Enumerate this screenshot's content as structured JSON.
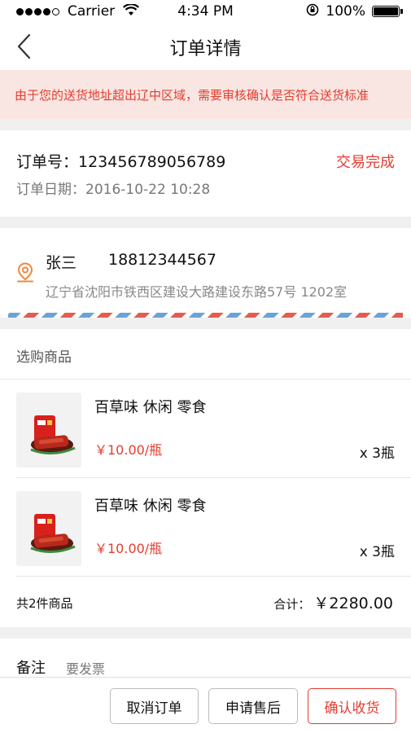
{
  "status_bar": {
    "carrier": "Carrier",
    "time": "4:34 PM",
    "battery_percent": "100%",
    "battery_level": 1.0,
    "signal_bars_filled": 4,
    "signal_bars_total": 5
  },
  "nav": {
    "title": "订单详情",
    "back_icon": "chevron-left-icon"
  },
  "notice": {
    "text": "由于您的送货地址超出辽中区域，需要审核确认是否符合送货标准"
  },
  "order": {
    "number_text": "订单号：123456789056789",
    "status": "交易完成",
    "date_text": "订单日期：2016-10-22   10:28"
  },
  "address": {
    "name": "张三",
    "phone": "18812344567",
    "detail": "辽宁省沈阳市铁西区建设大路建设东路57号 1202室",
    "icon": "location-pin-icon"
  },
  "goods": {
    "header": "选购商品",
    "items": [
      {
        "name": "百草味 休闲 零食",
        "price": "￥10.00/瓶",
        "quantity": "x 3瓶"
      },
      {
        "name": "百草味 休闲 零食",
        "price": "￥10.00/瓶",
        "quantity": "x 3瓶"
      }
    ],
    "count_text": "共2件商品",
    "total_label": "合计：",
    "total_value": "￥2280.00"
  },
  "remark": {
    "label": "备注",
    "text": "要发票"
  },
  "actions": {
    "cancel_label": "取消订单",
    "aftersale_label": "申请售后",
    "confirm_label": "确认收货"
  },
  "colors": {
    "accent": "#e53c2f",
    "notice_bg": "#f9e6e2",
    "page_bg": "#f0f0f0",
    "location_icon": "#f0873a"
  }
}
